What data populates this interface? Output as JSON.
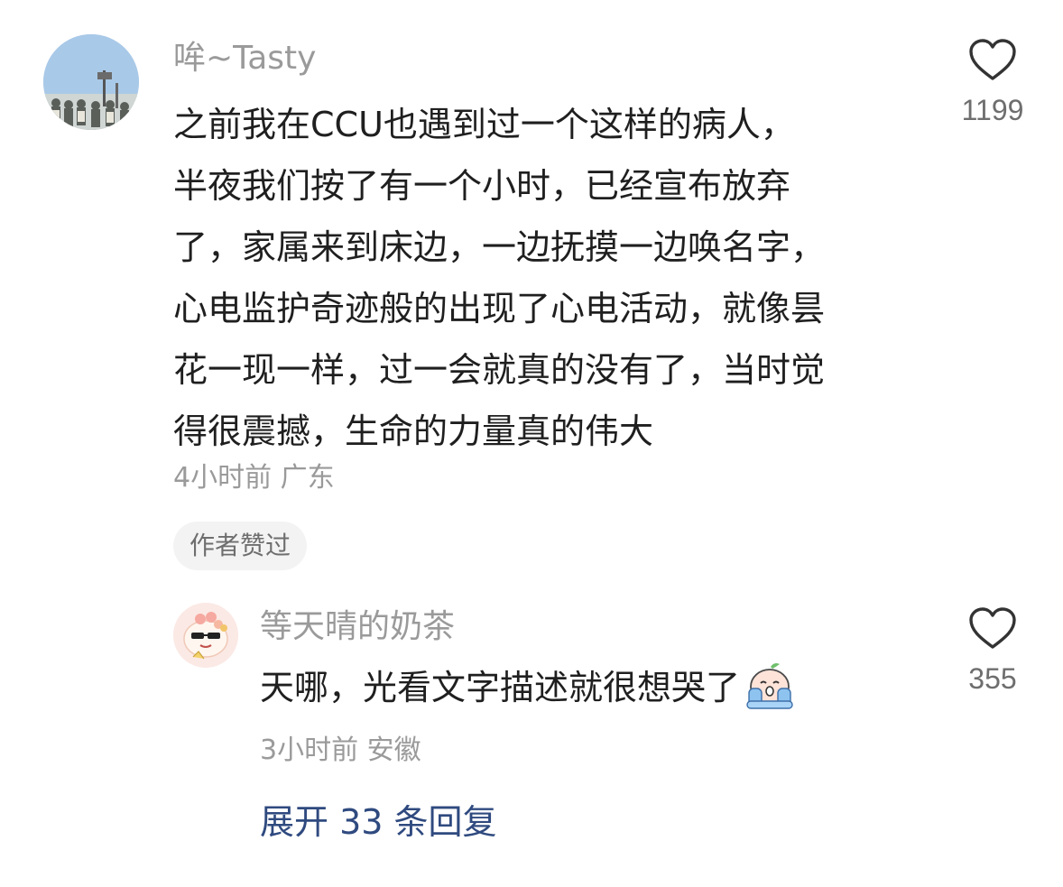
{
  "comment": {
    "username": "哞~Tasty",
    "lines": [
      "之前我在CCU也遇到过一个这样的病人，",
      "半夜我们按了有一个小时，已经宣布放弃",
      "了，家属来到床边，一边抚摸一边唤名字，",
      "心电监护奇迹般的出现了心电活动，就像昙",
      "花一现一样，过一会就真的没有了，当时觉",
      "得很震撼，生命的力量真的伟大"
    ],
    "meta": "4小时前 广东",
    "badge": "作者赞过",
    "like_count": "1199",
    "like_icon": "heart-outline-icon",
    "avatar_icon": "avatar-photo-icon"
  },
  "reply": {
    "username": "等天晴的奶茶",
    "text": "天哪，光看文字描述就很想哭了",
    "emoji_icon": "crying-emoji-icon",
    "meta": "3小时前 安徽",
    "like_count": "355",
    "like_icon": "heart-outline-icon",
    "avatar_icon": "cartoon-avatar-icon"
  },
  "expand_replies": "展开 33 条回复",
  "colors": {
    "text": "#1f1f1f",
    "muted": "#9a9a9a",
    "link": "#2f4a7f",
    "badge_bg": "#f3f3f3"
  }
}
